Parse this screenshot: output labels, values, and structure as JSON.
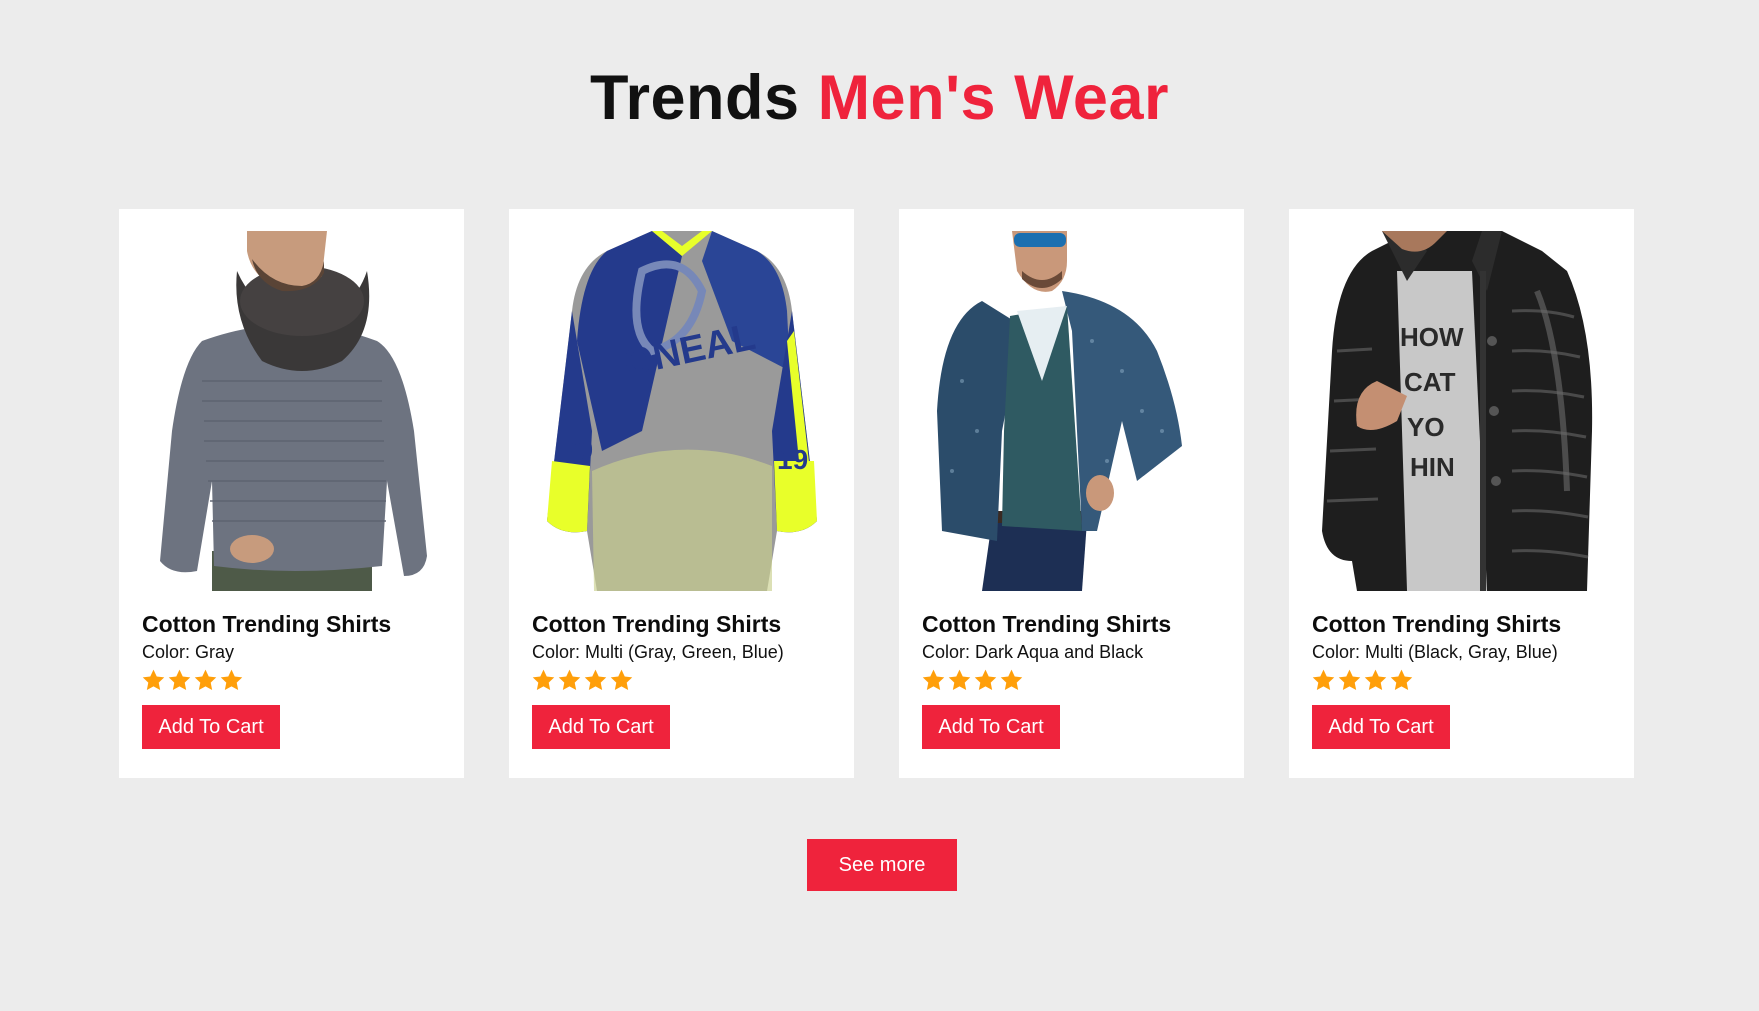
{
  "header": {
    "title_part1": "Trends",
    "title_part2": "Men's Wear",
    "accent_color": "#ef233c"
  },
  "products": [
    {
      "name": "Cotton Trending Shirts",
      "color_text": "Color: Gray",
      "rating_stars": 4,
      "button_label": "Add To Cart",
      "image": "man-in-gray-sweater-with-scarf"
    },
    {
      "name": "Cotton Trending Shirts",
      "color_text": "Color: Multi (Gray, Green, Blue)",
      "rating_stars": 4,
      "button_label": "Add To Cart",
      "image": "gray-blue-neon-motocross-jersey"
    },
    {
      "name": "Cotton Trending Shirts",
      "color_text": "Color: Dark Aqua and Black",
      "rating_stars": 4,
      "button_label": "Add To Cart",
      "image": "man-in-dark-aqua-cardigan-and-sunglasses"
    },
    {
      "name": "Cotton Trending Shirts",
      "color_text": "Color: Multi (Black, Gray, Blue)",
      "rating_stars": 4,
      "button_label": "Add To Cart",
      "image": "man-in-black-puffer-jacket"
    }
  ],
  "footer": {
    "see_more_label": "See more"
  },
  "colors": {
    "background": "#ececec",
    "card": "#ffffff",
    "button": "#ef233c",
    "star": "#ff9f0a"
  },
  "icons": [
    "star-icon"
  ]
}
